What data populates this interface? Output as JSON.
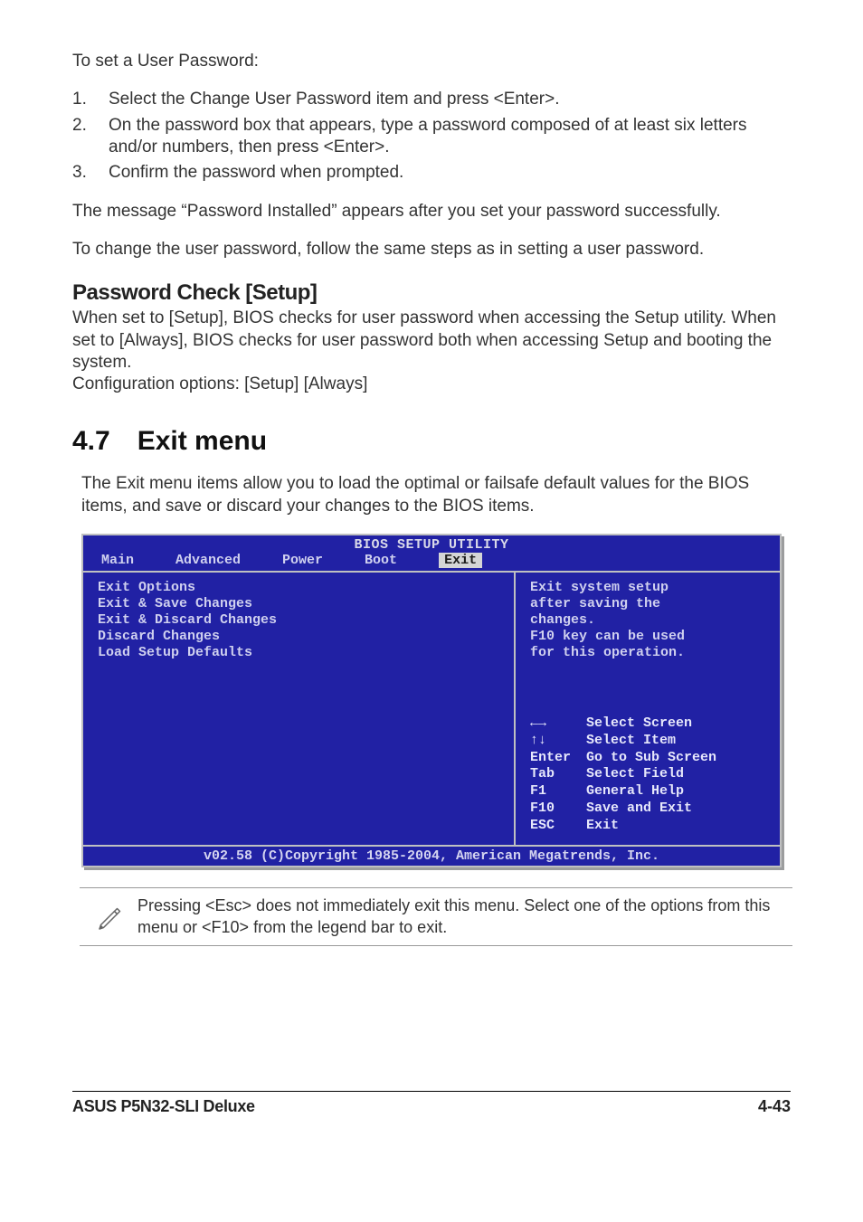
{
  "intro": "To set a User Password:",
  "steps": [
    "Select the Change User Password item and press <Enter>.",
    "On the password box that appears, type a password composed of at least six letters and/or numbers, then press <Enter>.",
    "Confirm the password when prompted."
  ],
  "para_installed": "The message “Password Installed” appears after you set your password successfully.",
  "para_change": "To change the user password, follow the same steps as in setting a user password.",
  "pwcheck_heading": "Password Check [Setup]",
  "pwcheck_body1": "When set to [Setup], BIOS checks for user password when accessing the Setup utility. When set to [Always], BIOS checks for user password both when accessing Setup and booting the system.",
  "pwcheck_body2": "Configuration options: [Setup] [Always]",
  "exit_heading": "4.7 Exit menu",
  "exit_body": "The Exit menu items allow you to load the optimal or failsafe default values for the BIOS items, and save or discard your changes to the BIOS items.",
  "bios": {
    "title": "BIOS SETUP UTILITY",
    "tabs": [
      "Main",
      "Advanced",
      "Power",
      "Boot",
      "Exit"
    ],
    "selected_tab": 4,
    "left": [
      "Exit Options",
      "",
      "Exit & Save Changes",
      "Exit & Discard Changes",
      "Discard Changes",
      "",
      "Load Setup Defaults"
    ],
    "right_info": [
      "Exit system setup",
      "after saving the",
      "changes.",
      "F10 key can be used",
      "for this operation."
    ],
    "right_keys": [
      {
        "key": "←→",
        "label": "Select Screen"
      },
      {
        "key": "↑↓",
        "label": "Select Item"
      },
      {
        "key": "Enter",
        "label": "Go to Sub Screen"
      },
      {
        "key": "Tab",
        "label": "Select Field"
      },
      {
        "key": "F1",
        "label": "General Help"
      },
      {
        "key": "F10",
        "label": "Save and Exit"
      },
      {
        "key": "ESC",
        "label": "Exit"
      }
    ],
    "footer": "v02.58 (C)Copyright 1985-2004, American Megatrends, Inc."
  },
  "note_text": "Pressing <Esc> does not immediately exit this menu. Select one of the options from this menu or <F10> from the legend bar to exit.",
  "footer_left": "ASUS P5N32-SLI Deluxe",
  "footer_right": "4-43"
}
